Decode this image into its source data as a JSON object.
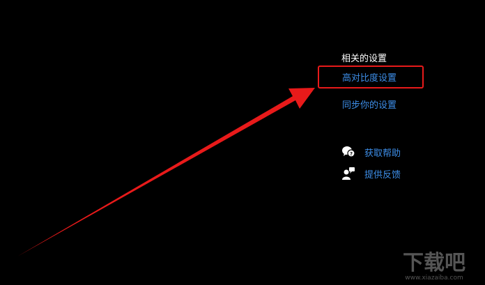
{
  "related_settings": {
    "title": "相关的设置",
    "links": {
      "high_contrast": "高对比度设置",
      "sync_settings": "同步你的设置"
    }
  },
  "help": {
    "get_help_label": "获取帮助",
    "feedback_label": "提供反馈"
  },
  "watermark": {
    "brand": "下载吧",
    "url": "www.xiazaiba.com"
  },
  "colors": {
    "background": "#000000",
    "link": "#3d8ee8",
    "annotation": "#e81a1a",
    "title": "#ffffff"
  },
  "icons": {
    "get_help": "chat-bubble-question-icon",
    "feedback": "person-feedback-icon"
  }
}
